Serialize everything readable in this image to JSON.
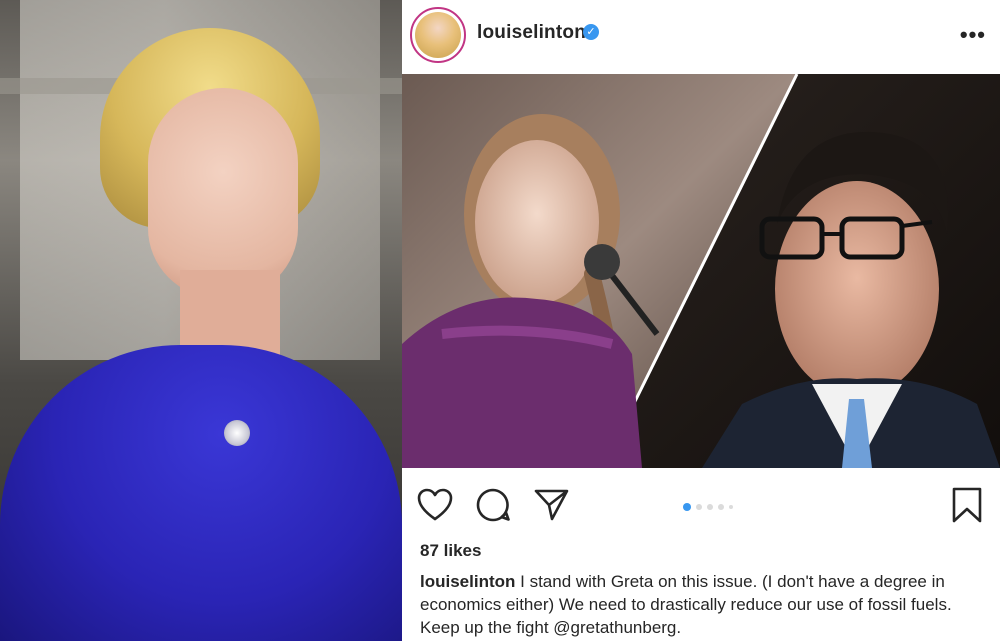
{
  "post": {
    "username": "louiselinton",
    "verified_icon": "verified-badge-icon",
    "more_icon": "more-options-icon",
    "likes": "87 likes",
    "caption_user": "louiselinton",
    "caption_text": "I stand with Greta on this issue. (I don't have a degree in economics either) We need to drastically reduce our use of fossil fuels. Keep up the fight @gretathunberg.",
    "carousel": {
      "count": 5,
      "active_index": 0
    },
    "icons": {
      "like": "heart-icon",
      "comment": "comment-icon",
      "share": "paper-plane-icon",
      "save": "bookmark-icon"
    }
  },
  "colors": {
    "text": "#262626",
    "verified_blue": "#3897f0",
    "inactive_dot": "#dbdbdb",
    "dress_blue": "#2a24b5"
  }
}
